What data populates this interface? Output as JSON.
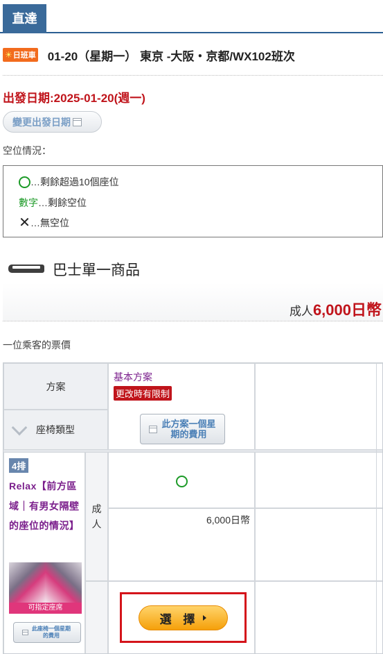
{
  "header": {
    "tab_label": "直達"
  },
  "route": {
    "day_badge_icon": "sun-icon",
    "day_badge": "日班車",
    "text": "01-20（星期一） 東京 -大阪・京都/WX102班次"
  },
  "departure": {
    "date_text": "出發日期:2025-01-20(週一)",
    "change_button": "變更出發日期"
  },
  "availability": {
    "title": "空位情況：",
    "legend": [
      {
        "icon": "circle-icon",
        "text": "…剩餘超過10個座位"
      },
      {
        "icon_text": "數字",
        "text": "…剩餘空位"
      },
      {
        "icon": "cross-icon",
        "symbol": "✕",
        "text": "…無空位"
      }
    ]
  },
  "product": {
    "icon": "bus-icon",
    "title": "巴士單一商品",
    "price_prefix": "成人",
    "price_value": "6,000日幣"
  },
  "fare_note": "一位乘客的票價",
  "table": {
    "plan_header": "方案",
    "seat_type_header": "座椅類型",
    "basic_plan": {
      "name": "基本方案",
      "restriction_badge": "更改時有限制",
      "week_fare_button": "此方案一個星期的費用"
    },
    "seat": {
      "row_badge": "4排",
      "name": "Relax【前方區域｜有男女隔壁的座位的情況】",
      "photo_caption": "可指定座席",
      "week_button": "此座椅一個星期的費用"
    },
    "passenger_type": "成人",
    "availability_symbol": "circle-icon",
    "fare": "6,000日幣",
    "select_button": "選 擇"
  },
  "colors": {
    "header_tab": "#3a6a9a",
    "accent_red": "#c0141b",
    "plan_purple": "#7b1f8c",
    "available_green": "#1c9a27",
    "select_orange": "#f5a00a",
    "highlight_box": "#d4141b"
  }
}
